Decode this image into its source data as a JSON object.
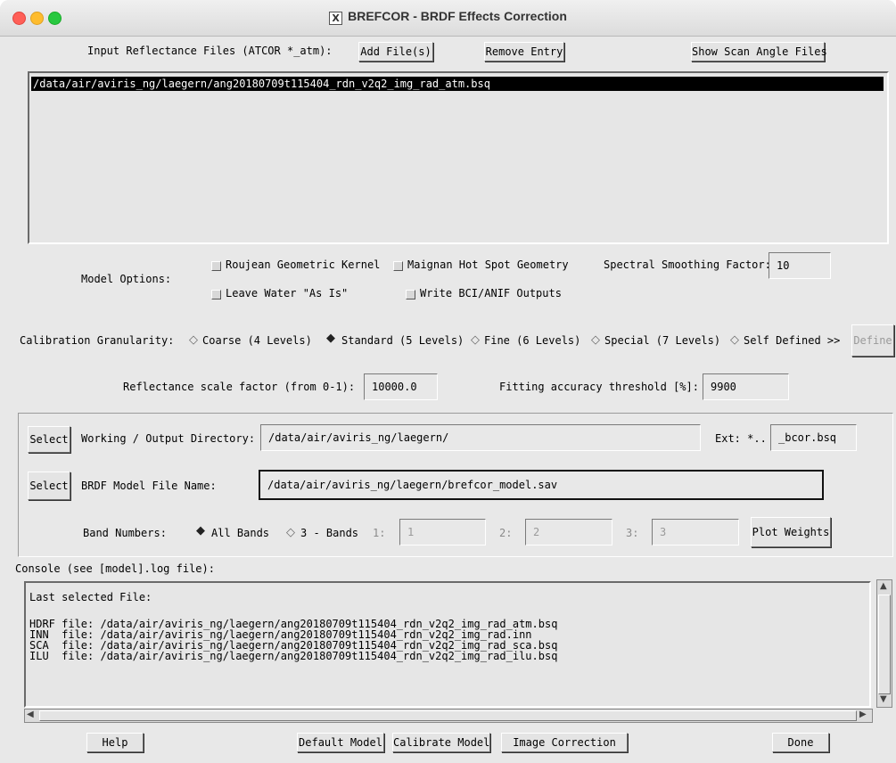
{
  "window": {
    "title": "BREFCOR - BRDF Effects Correction"
  },
  "input_files": {
    "label": "Input Reflectance Files (ATCOR *_atm):",
    "add_button": "Add File(s)",
    "remove_button": "Remove Entry",
    "show_scan_button": "Show Scan Angle Files",
    "items": [
      "/data/air/aviris_ng/laegern/ang20180709t115404_rdn_v2q2_img_rad_atm.bsq"
    ]
  },
  "model_options": {
    "label": "Model Options:",
    "roujean": "Roujean Geometric Kernel",
    "maignan": "Maignan Hot Spot Geometry",
    "leave_water": "Leave Water \"As Is\"",
    "write_bci": "Write BCI/ANIF Outputs",
    "spectral_label": "Spectral Smoothing Factor:",
    "spectral_value": "10"
  },
  "calibration": {
    "label": "Calibration Granularity:",
    "options": [
      "Coarse (4 Levels)",
      "Standard (5 Levels)",
      "Fine (6 Levels)",
      "Special (7 Levels)",
      "Self Defined >>"
    ],
    "selected_index": 1,
    "define_button": "Define"
  },
  "scale": {
    "reflectance_label": "Reflectance scale factor (from 0-1):",
    "reflectance_value": "10000.0",
    "fitting_label": "Fitting accuracy threshold [%]:",
    "fitting_value": "9900"
  },
  "output": {
    "select_label": "Select",
    "working_dir_label": "Working / Output Directory:",
    "working_dir_value": "/data/air/aviris_ng/laegern/",
    "ext_label": "Ext: *..",
    "ext_value": "_bcor.bsq",
    "model_file_label": "BRDF Model File Name:",
    "model_file_value": "/data/air/aviris_ng/laegern/brefcor_model.sav"
  },
  "bands": {
    "label": "Band Numbers:",
    "all_bands": "All Bands",
    "three_bands": "3 - Bands",
    "b1_label": "1:",
    "b1_value": "1",
    "b2_label": "2:",
    "b2_value": "2",
    "b3_label": "3:",
    "b3_value": "3",
    "plot_button": "Plot Weights"
  },
  "console": {
    "label": "Console (see [model].log file):",
    "lines": [
      "Last selected File:",
      "",
      "HDRF file: /data/air/aviris_ng/laegern/ang20180709t115404_rdn_v2q2_img_rad_atm.bsq",
      "INN  file: /data/air/aviris_ng/laegern/ang20180709t115404_rdn_v2q2_img_rad.inn",
      "SCA  file: /data/air/aviris_ng/laegern/ang20180709t115404_rdn_v2q2_img_rad_sca.bsq",
      "ILU  file: /data/air/aviris_ng/laegern/ang20180709t115404_rdn_v2q2_img_rad_ilu.bsq"
    ]
  },
  "footer": {
    "help": "Help",
    "default_model": "Default Model",
    "calibrate_model": "Calibrate Model",
    "image_correction": "Image Correction",
    "done": "Done"
  }
}
